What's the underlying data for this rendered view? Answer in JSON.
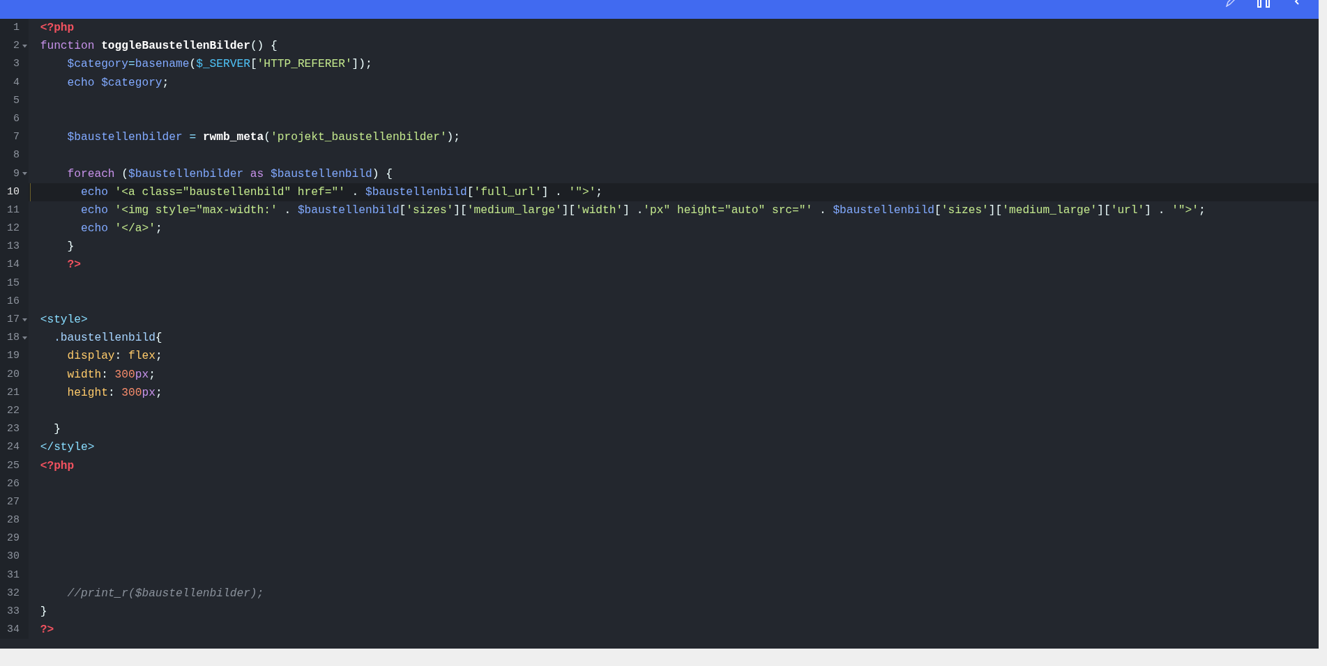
{
  "editor": {
    "lines": [
      {
        "number": "1",
        "fold": false,
        "selected": false,
        "tokens": [
          {
            "kind": "tag",
            "text": "<?php"
          }
        ]
      },
      {
        "number": "2",
        "fold": true,
        "selected": false,
        "tokens": [
          {
            "kind": "keyword",
            "text": "function"
          },
          {
            "kind": "name",
            "text": " toggleBaustellenBilder"
          },
          {
            "kind": "plain",
            "text": "() {"
          }
        ]
      },
      {
        "number": "3",
        "fold": false,
        "selected": false,
        "tokens": [
          {
            "kind": "variable",
            "text": "    $category"
          },
          {
            "kind": "operator",
            "text": "="
          },
          {
            "kind": "builtin",
            "text": "basename"
          },
          {
            "kind": "plain",
            "text": "("
          },
          {
            "kind": "superglobal",
            "text": "$_SERVER"
          },
          {
            "kind": "plain",
            "text": "["
          },
          {
            "kind": "string",
            "text": "'HTTP_REFERER'"
          },
          {
            "kind": "plain",
            "text": "]);"
          }
        ]
      },
      {
        "number": "4",
        "fold": false,
        "selected": false,
        "tokens": [
          {
            "kind": "builtin",
            "text": "    echo"
          },
          {
            "kind": "variable",
            "text": " $category"
          },
          {
            "kind": "plain",
            "text": ";"
          }
        ]
      },
      {
        "number": "5",
        "fold": false,
        "selected": false
      },
      {
        "number": "6",
        "fold": false,
        "selected": false
      },
      {
        "number": "7",
        "fold": false,
        "selected": false,
        "tokens": [
          {
            "kind": "variable",
            "text": "    $baustellenbilder"
          },
          {
            "kind": "operator",
            "text": " = "
          },
          {
            "kind": "name",
            "text": "rwmb_meta"
          },
          {
            "kind": "plain",
            "text": "("
          },
          {
            "kind": "string",
            "text": "'projekt_baustellenbilder'"
          },
          {
            "kind": "plain",
            "text": ");"
          }
        ]
      },
      {
        "number": "8",
        "fold": false,
        "selected": false
      },
      {
        "number": "9",
        "fold": true,
        "selected": false,
        "tokens": [
          {
            "kind": "keyword",
            "text": "    foreach"
          },
          {
            "kind": "plain",
            "text": " ("
          },
          {
            "kind": "variable",
            "text": "$baustellenbilder"
          },
          {
            "kind": "keyword",
            "text": " as "
          },
          {
            "kind": "variable",
            "text": "$baustellenbild"
          },
          {
            "kind": "plain",
            "text": ") {"
          }
        ]
      },
      {
        "number": "10",
        "fold": false,
        "selected": true,
        "tokens": [
          {
            "kind": "builtin",
            "text": "      echo"
          },
          {
            "kind": "string",
            "text": " '<a class=\"baustellenbild\" href=\"'"
          },
          {
            "kind": "plain",
            "text": " . "
          },
          {
            "kind": "variable",
            "text": "$baustellenbild"
          },
          {
            "kind": "plain",
            "text": "["
          },
          {
            "kind": "string",
            "text": "'full_url'"
          },
          {
            "kind": "plain",
            "text": "] . "
          },
          {
            "kind": "string",
            "text": "'\">'"
          },
          {
            "kind": "plain",
            "text": ";"
          }
        ]
      },
      {
        "number": "11",
        "fold": false,
        "selected": false,
        "tokens": [
          {
            "kind": "builtin",
            "text": "      echo"
          },
          {
            "kind": "string",
            "text": " '<img style=\"max-width:'"
          },
          {
            "kind": "plain",
            "text": " . "
          },
          {
            "kind": "variable",
            "text": "$baustellenbild"
          },
          {
            "kind": "plain",
            "text": "["
          },
          {
            "kind": "string",
            "text": "'sizes'"
          },
          {
            "kind": "plain",
            "text": "]["
          },
          {
            "kind": "string",
            "text": "'medium_large'"
          },
          {
            "kind": "plain",
            "text": "]["
          },
          {
            "kind": "string",
            "text": "'width'"
          },
          {
            "kind": "plain",
            "text": "] ."
          },
          {
            "kind": "string",
            "text": "'px\" height=\"auto\" src=\"'"
          },
          {
            "kind": "plain",
            "text": " . "
          },
          {
            "kind": "variable",
            "text": "$baustellenbild"
          },
          {
            "kind": "plain",
            "text": "["
          },
          {
            "kind": "string",
            "text": "'sizes'"
          },
          {
            "kind": "plain",
            "text": "]["
          },
          {
            "kind": "string",
            "text": "'medium_large'"
          },
          {
            "kind": "plain",
            "text": "]["
          },
          {
            "kind": "string",
            "text": "'url'"
          },
          {
            "kind": "plain",
            "text": "] . "
          },
          {
            "kind": "string",
            "text": "'\">'"
          },
          {
            "kind": "plain",
            "text": ";"
          }
        ]
      },
      {
        "number": "12",
        "fold": false,
        "selected": false,
        "tokens": [
          {
            "kind": "builtin",
            "text": "      echo"
          },
          {
            "kind": "string",
            "text": " '</a>'"
          },
          {
            "kind": "plain",
            "text": ";"
          }
        ]
      },
      {
        "number": "13",
        "fold": false,
        "selected": false,
        "tokens": [
          {
            "kind": "plain",
            "text": "    }"
          }
        ]
      },
      {
        "number": "14",
        "fold": false,
        "selected": false,
        "tokens": [
          {
            "kind": "tag",
            "text": "    ?>"
          }
        ]
      },
      {
        "number": "15",
        "fold": false,
        "selected": false
      },
      {
        "number": "16",
        "fold": false,
        "selected": false
      },
      {
        "number": "17",
        "fold": true,
        "selected": false,
        "tokens": [
          {
            "kind": "htmltag",
            "text": "<style>"
          }
        ]
      },
      {
        "number": "18",
        "fold": true,
        "selected": false,
        "tokens": [
          {
            "kind": "selector",
            "text": "  .baustellenbild"
          },
          {
            "kind": "plain",
            "text": "{"
          }
        ]
      },
      {
        "number": "19",
        "fold": false,
        "selected": false,
        "tokens": [
          {
            "kind": "property",
            "text": "    display"
          },
          {
            "kind": "plain",
            "text": ": "
          },
          {
            "kind": "value",
            "text": "flex"
          },
          {
            "kind": "plain",
            "text": ";"
          }
        ]
      },
      {
        "number": "20",
        "fold": false,
        "selected": false,
        "tokens": [
          {
            "kind": "property",
            "text": "    width"
          },
          {
            "kind": "plain",
            "text": ": "
          },
          {
            "kind": "number",
            "text": "300"
          },
          {
            "kind": "unit",
            "text": "px"
          },
          {
            "kind": "plain",
            "text": ";"
          }
        ]
      },
      {
        "number": "21",
        "fold": false,
        "selected": false,
        "tokens": [
          {
            "kind": "property",
            "text": "    height"
          },
          {
            "kind": "plain",
            "text": ": "
          },
          {
            "kind": "number",
            "text": "300"
          },
          {
            "kind": "unit",
            "text": "px"
          },
          {
            "kind": "plain",
            "text": ";"
          }
        ]
      },
      {
        "number": "22",
        "fold": false,
        "selected": false
      },
      {
        "number": "23",
        "fold": false,
        "selected": false,
        "tokens": [
          {
            "kind": "plain",
            "text": "  }"
          }
        ]
      },
      {
        "number": "24",
        "fold": false,
        "selected": false,
        "tokens": [
          {
            "kind": "htmltag",
            "text": "</style>"
          }
        ]
      },
      {
        "number": "25",
        "fold": false,
        "selected": false,
        "tokens": [
          {
            "kind": "tag",
            "text": "<?php"
          }
        ]
      },
      {
        "number": "26",
        "fold": false,
        "selected": false
      },
      {
        "number": "27",
        "fold": false,
        "selected": false
      },
      {
        "number": "28",
        "fold": false,
        "selected": false
      },
      {
        "number": "29",
        "fold": false,
        "selected": false
      },
      {
        "number": "30",
        "fold": false,
        "selected": false
      },
      {
        "number": "31",
        "fold": false,
        "selected": false
      },
      {
        "number": "32",
        "fold": false,
        "selected": false,
        "tokens": [
          {
            "kind": "comment",
            "text": "    //print_r($baustellenbilder);"
          }
        ]
      },
      {
        "number": "33",
        "fold": false,
        "selected": false,
        "tokens": [
          {
            "kind": "plain",
            "text": "}"
          }
        ]
      },
      {
        "number": "34",
        "fold": false,
        "selected": false,
        "tokens": [
          {
            "kind": "tag",
            "text": "?>"
          }
        ]
      }
    ]
  }
}
